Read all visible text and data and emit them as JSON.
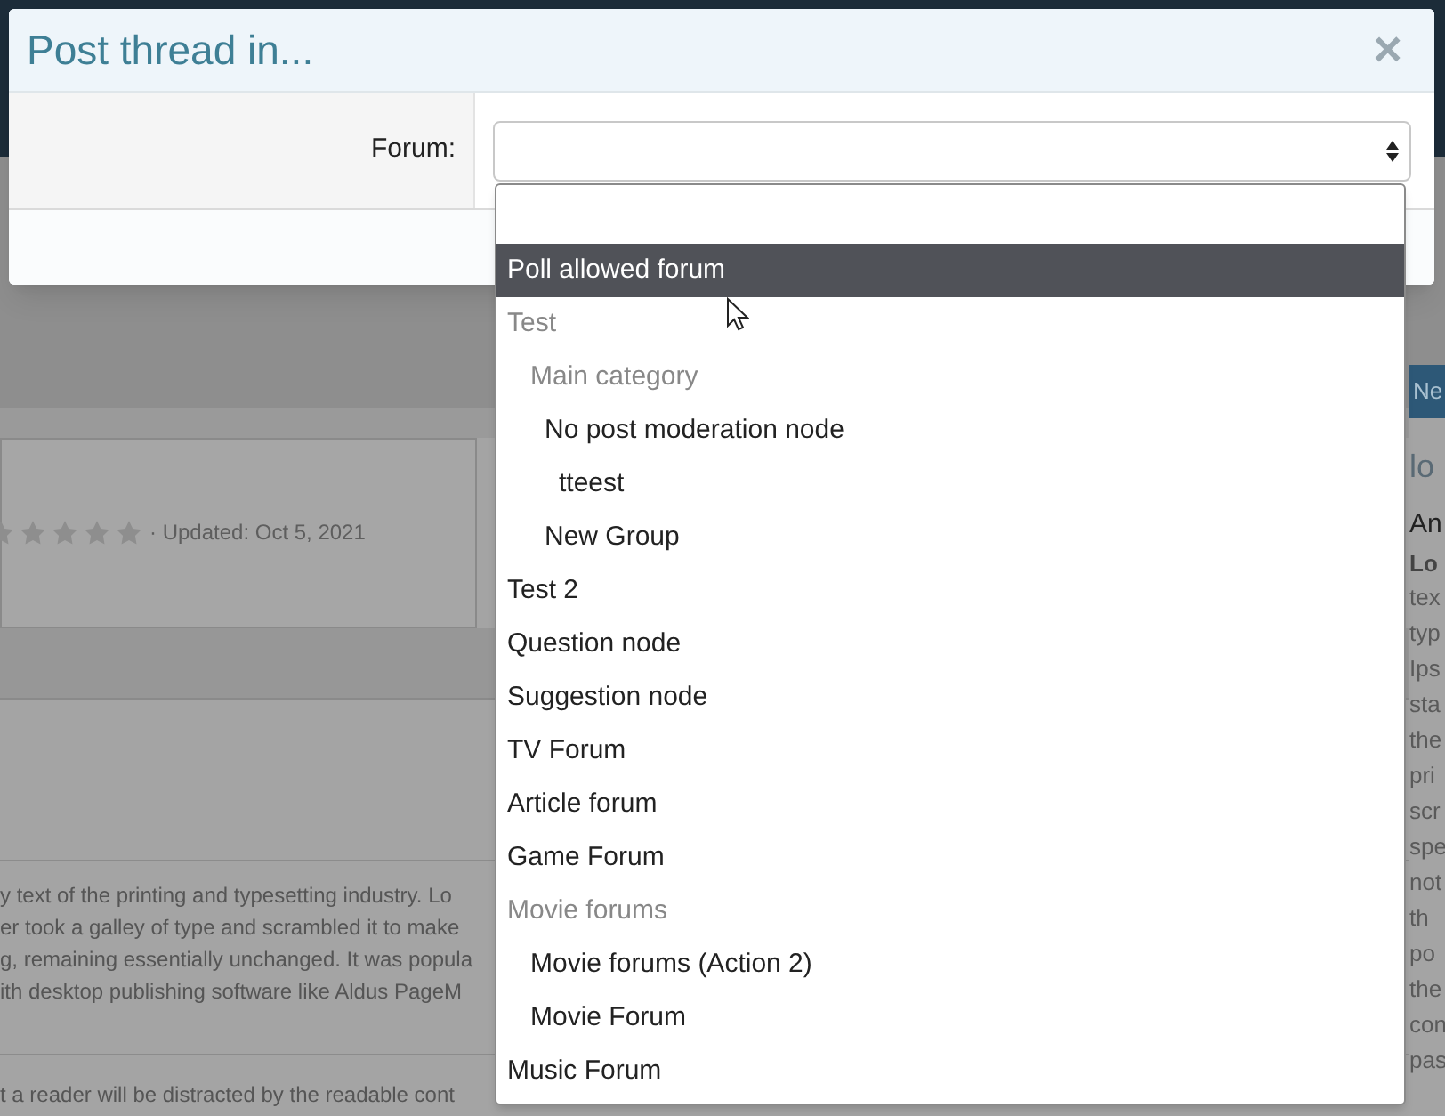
{
  "background": {
    "rating": {
      "stars": 0,
      "updated": "· Updated: Oct 5, 2021"
    },
    "paragraph_1": [
      "y text of the printing and typesetting industry. Lo",
      "er took a galley of type and scrambled it to make",
      "g, remaining essentially unchanged. It was popula",
      "ith desktop publishing software like Aldus PageM"
    ],
    "paragraph_2": "t a reader will be distracted by the readable cont",
    "side_button": "Ne",
    "side_heading": "lo",
    "side_title": "An",
    "side_bold": "Lo",
    "side_lines": [
      "tex",
      "typ",
      "Ips",
      "sta",
      "the",
      "pri",
      "scr",
      "spe",
      "not",
      "th",
      "po",
      "the",
      "con",
      "pas"
    ]
  },
  "dialog": {
    "title": "Post thread in...",
    "close": "×",
    "field_label": "Forum:",
    "dropdown": {
      "items": [
        {
          "kind": "blank",
          "selected": false
        },
        {
          "kind": "forum",
          "label": "Poll allowed forum",
          "selected": true
        },
        {
          "kind": "category",
          "label": "Test",
          "selected": false,
          "children": [
            {
              "kind": "category",
              "label": "Main category",
              "selected": false,
              "children": [
                {
                  "kind": "forum",
                  "label": "No post moderation node",
                  "selected": false,
                  "children": [
                    {
                      "kind": "forum",
                      "label": "tteest",
                      "selected": false
                    }
                  ]
                },
                {
                  "kind": "forum",
                  "label": "New Group",
                  "selected": false
                }
              ]
            }
          ]
        },
        {
          "kind": "forum",
          "label": "Test 2",
          "selected": false
        },
        {
          "kind": "forum",
          "label": "Question node",
          "selected": false
        },
        {
          "kind": "forum",
          "label": "Suggestion node",
          "selected": false
        },
        {
          "kind": "forum",
          "label": "TV Forum",
          "selected": false
        },
        {
          "kind": "forum",
          "label": "Article forum",
          "selected": false
        },
        {
          "kind": "forum",
          "label": "Game Forum",
          "selected": false
        },
        {
          "kind": "category",
          "label": "Movie forums",
          "selected": false,
          "children": [
            {
              "kind": "forum",
              "label": "Movie forums (Action 2)",
              "selected": false
            },
            {
              "kind": "forum",
              "label": "Movie Forum",
              "selected": false
            }
          ]
        },
        {
          "kind": "forum",
          "label": "Music Forum",
          "selected": false
        }
      ]
    }
  }
}
